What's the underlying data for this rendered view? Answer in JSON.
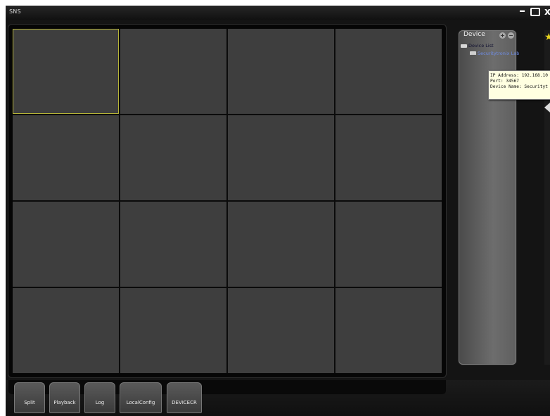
{
  "window": {
    "title": "SNS"
  },
  "video_grid": {
    "rows": 4,
    "columns": 4,
    "selected_cell": 1
  },
  "device_panel": {
    "title": "Device",
    "tree_root": "Device List",
    "tree_child": "Securitytronix Lab"
  },
  "tooltip": {
    "ip_line": "IP Address: 192.168.10",
    "port_line": "Port: 34567",
    "name_line": "Device Name: Securityt"
  },
  "toolbar": {
    "split": "Split",
    "playback": "Playback",
    "log": "Log",
    "localconfig": "LocalConfig",
    "devicecr": "DEVICECR"
  },
  "colors": {
    "selected_border": "#b7b53a",
    "tree_link": "#6f8de6",
    "tooltip_bg": "#ffffe1"
  }
}
